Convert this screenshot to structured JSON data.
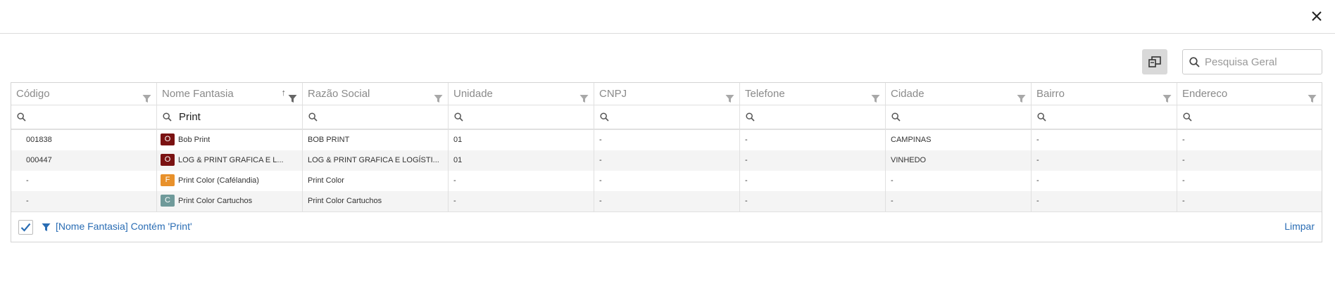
{
  "dialog": {
    "close_glyph": "✕"
  },
  "toolbar": {
    "columns_icon": "column-chooser-icon"
  },
  "search": {
    "placeholder": "Pesquisa Geral",
    "value": ""
  },
  "grid": {
    "columns": [
      {
        "label": "Código"
      },
      {
        "label": "Nome Fantasia",
        "sort_glyph": "↑"
      },
      {
        "label": "Razão Social"
      },
      {
        "label": "Unidade"
      },
      {
        "label": "CNPJ"
      },
      {
        "label": "Telefone"
      },
      {
        "label": "Cidade"
      },
      {
        "label": "Bairro"
      },
      {
        "label": "Endereco"
      }
    ],
    "filters": [
      "",
      "Print",
      "",
      "",
      "",
      "",
      "",
      "",
      ""
    ],
    "rows": [
      {
        "codigo": "001838",
        "badge": "O",
        "badge_color": "#7a1212",
        "nome_fantasia": "Bob Print",
        "razao_social": "BOB PRINT",
        "unidade": "01",
        "cnpj": "-",
        "telefone": "-",
        "cidade": "CAMPINAS",
        "bairro": "-",
        "endereco": "-"
      },
      {
        "codigo": "000447",
        "badge": "O",
        "badge_color": "#7a1212",
        "nome_fantasia": "LOG & PRINT GRAFICA E L...",
        "razao_social": "LOG & PRINT GRAFICA E LOGÍSTI...",
        "unidade": "01",
        "cnpj": "-",
        "telefone": "-",
        "cidade": "VINHEDO",
        "bairro": "-",
        "endereco": "-"
      },
      {
        "codigo": "-",
        "badge": "F",
        "badge_color": "#e8912b",
        "nome_fantasia": "Print Color (Cafélandia)",
        "razao_social": "Print Color",
        "unidade": "-",
        "cnpj": "-",
        "telefone": "-",
        "cidade": "-",
        "bairro": "-",
        "endereco": "-"
      },
      {
        "codigo": "-",
        "badge": "C",
        "badge_color": "#6f9a9a",
        "nome_fantasia": "Print Color Cartuchos",
        "razao_social": "Print Color Cartuchos",
        "unidade": "-",
        "cnpj": "-",
        "telefone": "-",
        "cidade": "-",
        "bairro": "-",
        "endereco": "-"
      }
    ]
  },
  "footer": {
    "filter_checked": true,
    "filter_text": "[Nome Fantasia] Contém 'Print'",
    "clear_label": "Limpar"
  },
  "colors": {
    "accent": "#2a6db4",
    "header_text": "#8a8a8a",
    "alt_row": "#f4f4f4"
  }
}
